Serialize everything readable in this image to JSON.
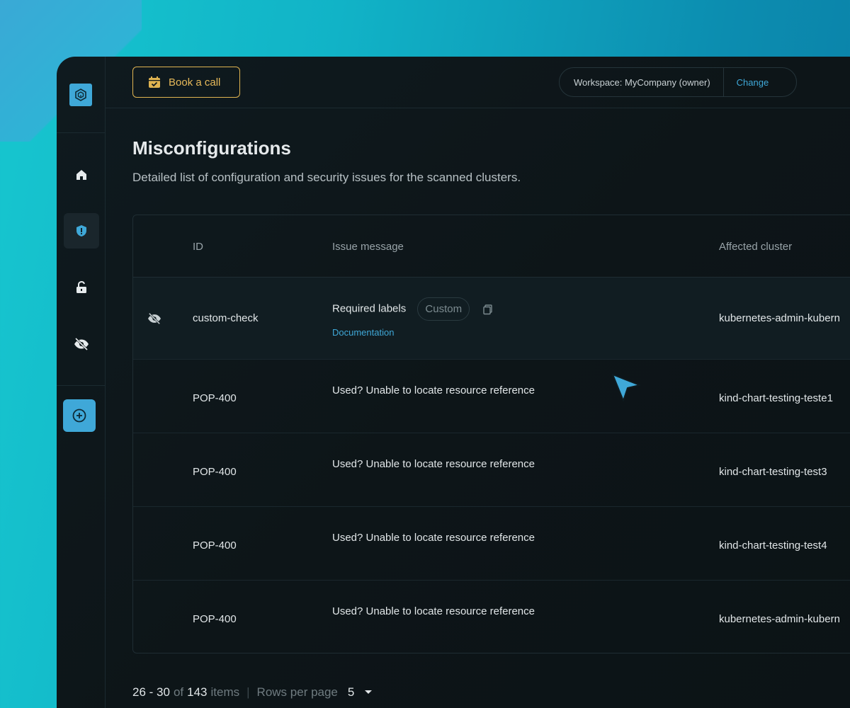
{
  "topbar": {
    "book_call_label": "Book a call",
    "workspace_label": "Workspace: MyCompany (owner)",
    "workspace_change": "Change"
  },
  "sidebar": {
    "items": [
      {
        "icon": "home-icon",
        "active": false
      },
      {
        "icon": "shield-alert-icon",
        "active": true
      },
      {
        "icon": "unlock-icon",
        "active": false
      },
      {
        "icon": "eye-off-icon",
        "active": false
      }
    ],
    "add_icon": "plus-circle-icon",
    "logo_icon": "cube-logo-icon"
  },
  "page": {
    "title": "Misconfigurations",
    "description": "Detailed list of configuration and security issues for the scanned clusters."
  },
  "table": {
    "headers": {
      "id": "ID",
      "message": "Issue message",
      "cluster": "Affected cluster"
    },
    "rows": [
      {
        "id": "custom-check",
        "message": "Required labels",
        "badge": "Custom",
        "link": "Documentation",
        "cluster": "kubernetes-admin-kubern",
        "hidden": true
      },
      {
        "id": "POP-400",
        "message": "Used? Unable to locate resource reference",
        "cluster": "kind-chart-testing-teste1"
      },
      {
        "id": "POP-400",
        "message": "Used? Unable to locate resource reference",
        "cluster": "kind-chart-testing-test3"
      },
      {
        "id": "POP-400",
        "message": "Used? Unable to locate resource reference",
        "cluster": "kind-chart-testing-test4"
      },
      {
        "id": "POP-400",
        "message": "Used? Unable to locate resource reference",
        "cluster": "kubernetes-admin-kubern"
      }
    ]
  },
  "pagination": {
    "range": "26 - 30",
    "of": "of",
    "total": "143",
    "items_word": "items",
    "separator": "|",
    "rows_per_page_label": "Rows per page",
    "rows_per_page_value": "5"
  },
  "colors": {
    "accent": "#3fa8d8",
    "book_call": "#e0b451",
    "background": "#0d1518"
  }
}
